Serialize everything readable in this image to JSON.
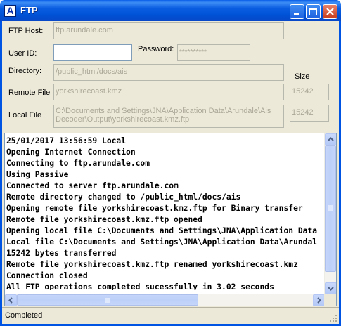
{
  "window": {
    "title": "FTP",
    "app_icon_letter": "A"
  },
  "form": {
    "ftp_host_label": "FTP Host:",
    "ftp_host_value": "ftp.arundale.com",
    "user_id_label": "User ID:",
    "user_id_value": "",
    "password_label": "Password:",
    "password_value": "**********",
    "directory_label": "Directory:",
    "directory_value": "/public_html/docs/ais",
    "size_label": "Size",
    "remote_file_label": "Remote File",
    "remote_file_value": "yorkshirecoast.kmz",
    "remote_size_value": "15242",
    "local_file_label": "Local File",
    "local_file_value": "C:\\Documents and Settings\\JNA\\Application Data\\Arundale\\Ais Decoder\\Output\\yorkshirecoast.kmz.ftp",
    "local_size_value": "15242"
  },
  "log": {
    "lines": [
      "25/01/2017 13:56:59 Local",
      "Opening Internet Connection",
      "Connecting to ftp.arundale.com",
      "Using Passive",
      "Connected to server ftp.arundale.com",
      "Remote directory changed to /public_html/docs/ais",
      "Opening remote file yorkshirecoast.kmz.ftp for Binary transfer",
      "Remote file yorkshirecoast.kmz.ftp opened",
      "Opening local file C:\\Documents and Settings\\JNA\\Application Data",
      "Local file C:\\Documents and Settings\\JNA\\Application Data\\Arundal",
      "15242 bytes transferred",
      "Remote file yorkshirecoast.kmz.ftp renamed yorkshirecoast.kmz",
      "Connection closed",
      "All FTP operations completed sucessfully in 3.02 seconds"
    ]
  },
  "status": {
    "text": "Completed"
  },
  "icons": {
    "minimize": "minimize-icon",
    "maximize": "maximize-icon",
    "close": "close-icon",
    "scroll_up": "arrow-up-icon",
    "scroll_down": "arrow-down-icon",
    "scroll_left": "arrow-left-icon",
    "scroll_right": "arrow-right-icon",
    "size_grip": "size-grip-icon"
  },
  "colors": {
    "titlebar": "#0054e3",
    "close_button": "#c63d1d",
    "window_face": "#ece9d8",
    "field_border": "#7f9db9",
    "disabled_text": "#aca899"
  }
}
